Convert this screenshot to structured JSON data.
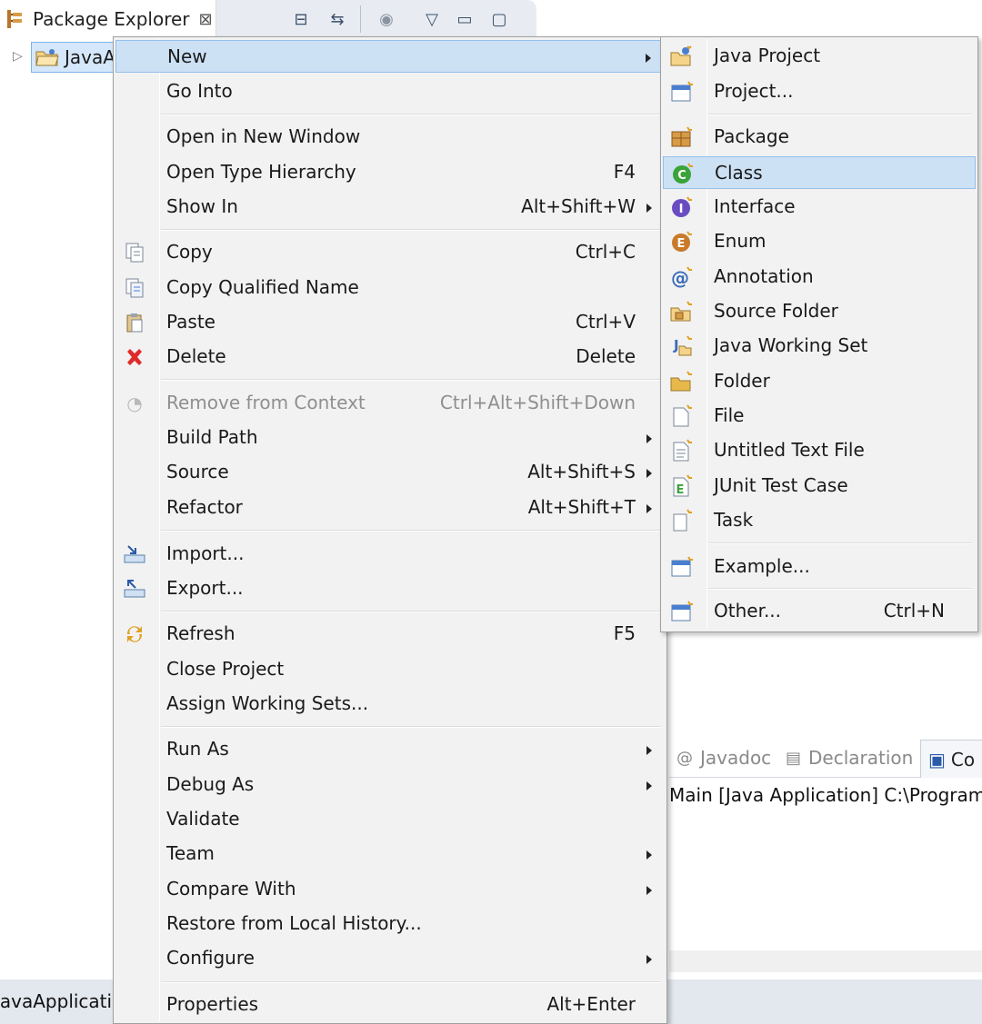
{
  "view": {
    "title": "Package Explorer",
    "close_glyph": "⊠",
    "tree_item": "JavaA",
    "tree_expander": "▷"
  },
  "view_toolbar": [
    {
      "icon": "collapse-all-icon",
      "glyph": "⊟"
    },
    {
      "icon": "link-with-editor-icon",
      "glyph": "⇆"
    },
    {
      "icon": "focus-icon",
      "glyph": "◉"
    },
    {
      "icon": "view-menu-icon",
      "glyph": "▽"
    },
    {
      "icon": "minimize-icon",
      "glyph": "▭"
    },
    {
      "icon": "maximize-icon",
      "glyph": "▢"
    }
  ],
  "bottom_panel": {
    "tabs": [
      {
        "label": "Javadoc",
        "glyph": "@"
      },
      {
        "label": "Declaration",
        "glyph": "▤"
      }
    ],
    "active_tab": "Co",
    "active_glyph": "▣",
    "console_line": "Main [Java Application] C:\\Program Fi"
  },
  "status": {
    "label": "JavaApplicatio"
  },
  "context_menu": {
    "items": [
      {
        "label": "New",
        "shortcut": "",
        "submenu": true
      },
      {
        "label": "Go Into",
        "shortcut": ""
      },
      {
        "label": "Open in New Window",
        "shortcut": ""
      },
      {
        "label": "Open Type Hierarchy",
        "shortcut": "F4"
      },
      {
        "label": "Show In",
        "shortcut": "Alt+Shift+W",
        "submenu": true
      },
      {
        "label": "Copy",
        "shortcut": "Ctrl+C"
      },
      {
        "label": "Copy Qualified Name",
        "shortcut": ""
      },
      {
        "label": "Paste",
        "shortcut": "Ctrl+V"
      },
      {
        "label": "Delete",
        "shortcut": "Delete"
      },
      {
        "label": "Remove from Context",
        "shortcut": "Ctrl+Alt+Shift+Down"
      },
      {
        "label": "Build Path",
        "shortcut": "",
        "submenu": true
      },
      {
        "label": "Source",
        "shortcut": "Alt+Shift+S",
        "submenu": true
      },
      {
        "label": "Refactor",
        "shortcut": "Alt+Shift+T",
        "submenu": true
      },
      {
        "label": "Import...",
        "shortcut": ""
      },
      {
        "label": "Export...",
        "shortcut": ""
      },
      {
        "label": "Refresh",
        "shortcut": "F5"
      },
      {
        "label": "Close Project",
        "shortcut": ""
      },
      {
        "label": "Assign Working Sets...",
        "shortcut": ""
      },
      {
        "label": "Run As",
        "shortcut": "",
        "submenu": true
      },
      {
        "label": "Debug As",
        "shortcut": "",
        "submenu": true
      },
      {
        "label": "Validate",
        "shortcut": ""
      },
      {
        "label": "Team",
        "shortcut": "",
        "submenu": true
      },
      {
        "label": "Compare With",
        "shortcut": "",
        "submenu": true
      },
      {
        "label": "Restore from Local History...",
        "shortcut": ""
      },
      {
        "label": "Configure",
        "shortcut": "",
        "submenu": true
      },
      {
        "label": "Properties",
        "shortcut": "Alt+Enter"
      }
    ],
    "icons": {
      "copy": "▤",
      "copy_qualified": "▤",
      "paste": "📋",
      "delete": "✖",
      "remove_context": "◔",
      "import": "⤵",
      "export": "⤴",
      "refresh": "⟳"
    }
  },
  "new_submenu": {
    "items": [
      {
        "label": "Java Project",
        "shortcut": "",
        "glyph": "✦"
      },
      {
        "label": "Project...",
        "shortcut": "",
        "glyph": "▣"
      },
      {
        "label": "Package",
        "shortcut": "",
        "glyph": "⊞"
      },
      {
        "label": "Class",
        "shortcut": "",
        "glyph": "C"
      },
      {
        "label": "Interface",
        "shortcut": "",
        "glyph": "I"
      },
      {
        "label": "Enum",
        "shortcut": "",
        "glyph": "E"
      },
      {
        "label": "Annotation",
        "shortcut": "",
        "glyph": "@"
      },
      {
        "label": "Source Folder",
        "shortcut": "",
        "glyph": "⊕"
      },
      {
        "label": "Java Working Set",
        "shortcut": "",
        "glyph": "J"
      },
      {
        "label": "Folder",
        "shortcut": "",
        "glyph": "▰"
      },
      {
        "label": "File",
        "shortcut": "",
        "glyph": "▯"
      },
      {
        "label": "Untitled Text File",
        "shortcut": "",
        "glyph": "≣"
      },
      {
        "label": "JUnit Test Case",
        "shortcut": "",
        "glyph": "E"
      },
      {
        "label": "Task",
        "shortcut": "",
        "glyph": "▯"
      },
      {
        "label": "Example...",
        "shortcut": "",
        "glyph": "▣"
      },
      {
        "label": "Other...",
        "shortcut": "Ctrl+N",
        "glyph": "▣"
      }
    ]
  },
  "colors": {
    "highlight": "#cde1f5",
    "highlight_border": "#94c0ea",
    "menu_bg": "#f2f2f2",
    "class_icon": "#3aa33a",
    "interface_icon": "#6a4cc2",
    "enum_icon": "#c87a2a",
    "delete_icon": "#e02b2b",
    "folder_icon": "#e8b84a"
  }
}
